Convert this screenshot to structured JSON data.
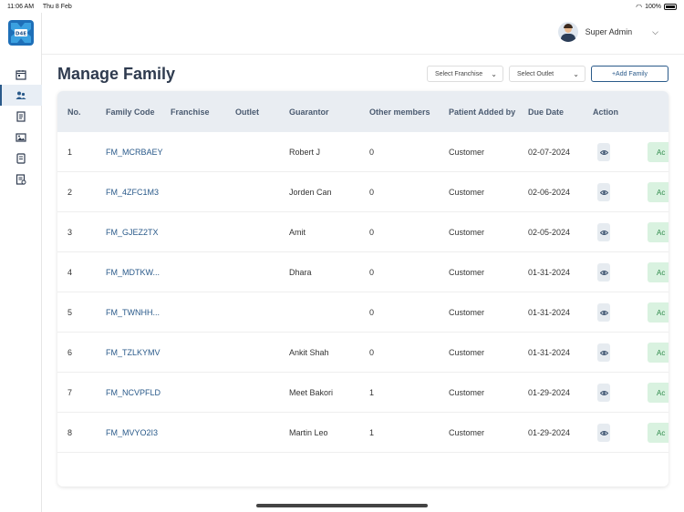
{
  "status_bar": {
    "time": "11:06 AM",
    "date": "Thu 8 Feb",
    "battery": "100%"
  },
  "brand": {
    "logo_text": "D4E",
    "accent": "#2a5a8a"
  },
  "sidebar": {
    "items": [
      {
        "icon": "calendar-icon"
      },
      {
        "icon": "family-icon",
        "active": true
      },
      {
        "icon": "document-icon"
      },
      {
        "icon": "image-icon"
      },
      {
        "icon": "list-icon"
      },
      {
        "icon": "report-icon"
      }
    ]
  },
  "header": {
    "user_name": "Super Admin"
  },
  "page": {
    "title": "Manage Family",
    "franchise_placeholder": "Select Franchise",
    "outlet_placeholder": "Select Outlet",
    "add_button": "+Add Family"
  },
  "table": {
    "columns": [
      "No.",
      "Family Code",
      "Franchise",
      "Outlet",
      "Guarantor",
      "Other members",
      "Patient Added by",
      "Due Date",
      "Action"
    ],
    "rows": [
      {
        "no": "1",
        "code": "FM_MCRBAEY",
        "franchise": "",
        "outlet": "",
        "guarantor": "Robert J",
        "others": "0",
        "added_by": "Customer",
        "due": "02-07-2024",
        "status": "Ac"
      },
      {
        "no": "2",
        "code": "FM_4ZFC1M3",
        "franchise": "",
        "outlet": "",
        "guarantor": "Jorden Can",
        "others": "0",
        "added_by": "Customer",
        "due": "02-06-2024",
        "status": "Ac"
      },
      {
        "no": "3",
        "code": "FM_GJEZ2TX",
        "franchise": "",
        "outlet": "",
        "guarantor": "Amit",
        "others": "0",
        "added_by": "Customer",
        "due": "02-05-2024",
        "status": "Ac"
      },
      {
        "no": "4",
        "code": "FM_MDTKW...",
        "franchise": "",
        "outlet": "",
        "guarantor": "Dhara",
        "others": "0",
        "added_by": "Customer",
        "due": "01-31-2024",
        "status": "Ac"
      },
      {
        "no": "5",
        "code": "FM_TWNHH...",
        "franchise": "",
        "outlet": "",
        "guarantor": "",
        "others": "0",
        "added_by": "Customer",
        "due": "01-31-2024",
        "status": "Ac"
      },
      {
        "no": "6",
        "code": "FM_TZLKYMV",
        "franchise": "",
        "outlet": "",
        "guarantor": "Ankit Shah",
        "others": "0",
        "added_by": "Customer",
        "due": "01-31-2024",
        "status": "Ac"
      },
      {
        "no": "7",
        "code": "FM_NCVPFLD",
        "franchise": "",
        "outlet": "",
        "guarantor": "Meet Bakori",
        "others": "1",
        "added_by": "Customer",
        "due": "01-29-2024",
        "status": "Ac"
      },
      {
        "no": "8",
        "code": "FM_MVYO2I3",
        "franchise": "",
        "outlet": "",
        "guarantor": "Martin Leo",
        "others": "1",
        "added_by": "Customer",
        "due": "01-29-2024",
        "status": "Ac"
      }
    ]
  }
}
